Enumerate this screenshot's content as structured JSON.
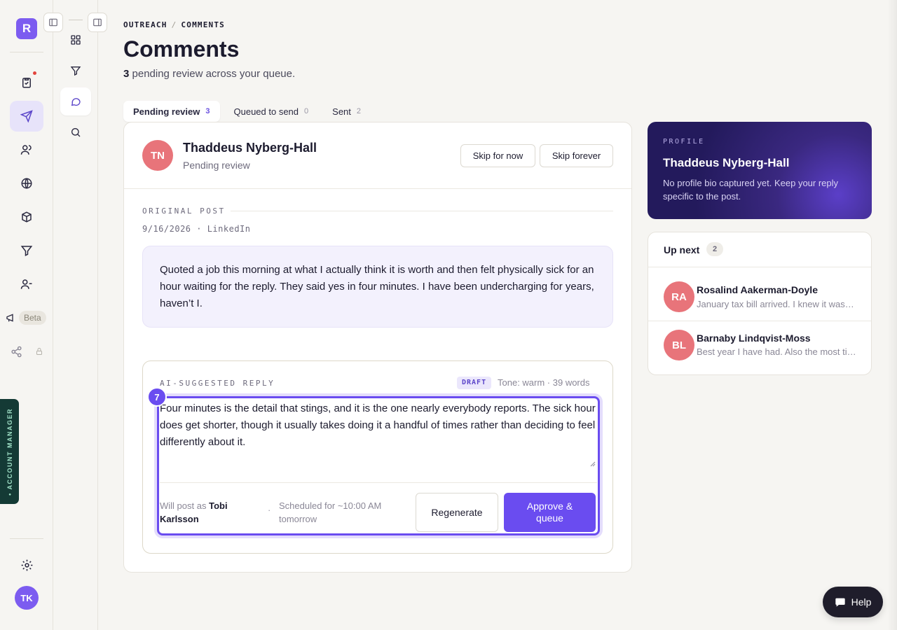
{
  "rail": {
    "brand_initial": "R",
    "beta_label": "Beta",
    "account_manager_label": "• ACCOUNT MANAGER",
    "user_initials": "TK"
  },
  "breadcrumb": {
    "parent": "OUTREACH",
    "separator": "/",
    "current": "COMMENTS"
  },
  "page": {
    "title": "Comments",
    "pending_count": "3",
    "subtitle_rest": "pending review across your queue."
  },
  "tabs": [
    {
      "label": "Pending review",
      "count": "3",
      "active": true
    },
    {
      "label": "Queued to send",
      "count": "0",
      "active": false
    },
    {
      "label": "Sent",
      "count": "2",
      "active": false
    }
  ],
  "card": {
    "initials": "TN",
    "name": "Thaddeus Nyberg-Hall",
    "status": "Pending review",
    "skip_now_label": "Skip for now",
    "skip_forever_label": "Skip forever",
    "original_post_label": "ORIGINAL POST",
    "post_meta": "9/16/2026 · LinkedIn",
    "post_text": "Quoted a job this morning at what I actually think it is worth and then felt physically sick for an hour waiting for the reply. They said yes in four minutes. I have been undercharging for years, haven’t I."
  },
  "reply": {
    "label": "AI-SUGGESTED REPLY",
    "badge": "DRAFT",
    "tone": "Tone: warm · 39 words",
    "step": "7",
    "text": "Four minutes is the detail that stings, and it is the one nearly everybody reports. The sick hour does get shorter, though it usually takes doing it a handful of times rather than deciding to feel differently about it.",
    "post_as_prefix": "Will post as",
    "post_as_name": "Tobi Karlsson",
    "separator": "·",
    "schedule": "Scheduled for ~10:00 AM tomorrow",
    "regenerate_label": "Regenerate",
    "approve_label": "Approve & queue"
  },
  "profile": {
    "label": "PROFILE",
    "name": "Thaddeus Nyberg-Hall",
    "bio": "No profile bio captured yet. Keep your reply specific to the post."
  },
  "up_next": {
    "title": "Up next",
    "count": "2",
    "items": [
      {
        "initials": "RA",
        "name": "Rosalind Aakerman-Doyle",
        "snippet": "January tax bill arrived. I knew it was coming"
      },
      {
        "initials": "BL",
        "name": "Barnaby Lindqvist-Moss",
        "snippet": "Best year I have had. Also the most tired I have been"
      }
    ]
  },
  "help": {
    "label": "Help"
  },
  "colors": {
    "accent": "#6a4cf0",
    "avatar": "#e8747a",
    "profile_bg": "#231a5c"
  }
}
